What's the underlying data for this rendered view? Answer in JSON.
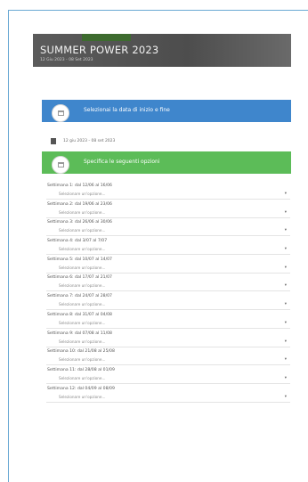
{
  "hero": {
    "title": "SUMMER POWER 2023",
    "dates": "12 Giu 2023 - 08 Set 2023"
  },
  "date_section": {
    "header": "Selezionai la data di inizio e fine",
    "date_range": "12 giu 2023 - 08 set 2023"
  },
  "options_section": {
    "header": "Specifica le seguenti opzioni",
    "weeks": [
      {
        "label": "Settimana 1: dal 12/06 al 16/06",
        "placeholder": "Selezionare un'opzione..."
      },
      {
        "label": "Settimana 2: dal 19/06 al 23/06",
        "placeholder": "Selezionare un'opzione..."
      },
      {
        "label": "Settimana 3: dal 26/06 al 30/06",
        "placeholder": "Selezionare un'opzione..."
      },
      {
        "label": "Settimana 4: dal 3/07 al 7/07",
        "placeholder": "Selezionare un'opzione..."
      },
      {
        "label": "Settimana 5: dal 10/07 al 14/07",
        "placeholder": "Selezionare un'opzione..."
      },
      {
        "label": "Settimana 6: dal 17/07 al 21/07",
        "placeholder": "Selezionare un'opzione..."
      },
      {
        "label": "Settimana 7: dal 24/07 al 28/07",
        "placeholder": "Selezionare un'opzione..."
      },
      {
        "label": "Settimana 8: dal 31/07 al 04/08",
        "placeholder": "Selezionare un'opzione..."
      },
      {
        "label": "Settimana 9: dal 07/08 al 11/08",
        "placeholder": "Selezionare un'opzione..."
      },
      {
        "label": "Settimana 10: dal 21/08 al 25/08",
        "placeholder": "Selezionare un'opzione..."
      },
      {
        "label": "Settimana 11: dal 28/08 al 01/09",
        "placeholder": "Selezionare un'opzione..."
      },
      {
        "label": "Settimana 12: dal 04/09 al 08/09",
        "placeholder": "Selezionare un'opzione..."
      }
    ]
  },
  "colors": {
    "blue_header": "#3f86cc",
    "green_header": "#5cbc58",
    "hero_bg": "#555555"
  }
}
